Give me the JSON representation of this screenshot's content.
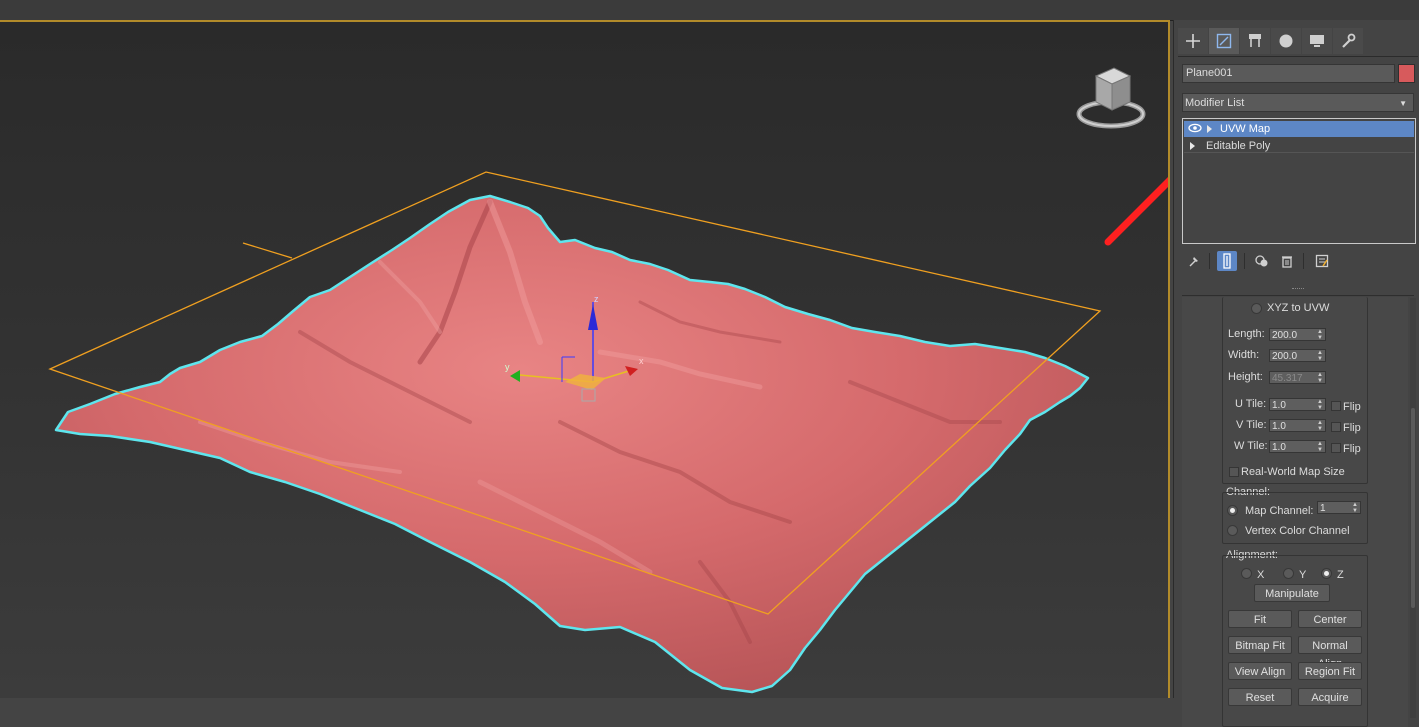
{
  "object": {
    "name": "Plane001",
    "color": "#d75a5c"
  },
  "modifier_list": {
    "label": "Modifier List"
  },
  "modifier_stack": [
    {
      "label": "UVW Map",
      "selected": true
    },
    {
      "label": "Editable Poly",
      "selected": false
    }
  ],
  "command_tabs": [
    "create-icon",
    "modify-icon",
    "hierarchy-icon",
    "motion-icon",
    "display-icon",
    "utilities-icon"
  ],
  "stack_tools": [
    "pin-stack-icon",
    "show-end-result-icon",
    "make-unique-icon",
    "remove-modifier-icon",
    "configure-modifier-sets-icon"
  ],
  "parameters": {
    "xyz_to_uvw": "XYZ to UVW",
    "length": {
      "label": "Length:",
      "value": "200.0"
    },
    "width": {
      "label": "Width:",
      "value": "200.0"
    },
    "height": {
      "label": "Height:",
      "value": "45.317"
    },
    "u_tile": {
      "label": "U Tile:",
      "value": "1.0",
      "flip": "Flip"
    },
    "v_tile": {
      "label": "V Tile:",
      "value": "1.0",
      "flip": "Flip"
    },
    "w_tile": {
      "label": "W Tile:",
      "value": "1.0",
      "flip": "Flip"
    },
    "real_world": "Real-World Map Size"
  },
  "channel": {
    "title": "Channel:",
    "map_channel": {
      "label": "Map Channel:",
      "value": "1"
    },
    "vertex_color": "Vertex Color Channel"
  },
  "alignment": {
    "title": "Alignment:",
    "axes": [
      "X",
      "Y",
      "Z"
    ],
    "selected_axis": "Z",
    "buttons": [
      "Manipulate",
      "Fit",
      "Center",
      "Bitmap Fit",
      "Normal Align",
      "View Align",
      "Region Fit",
      "Reset",
      "Acquire"
    ]
  },
  "gizmo_labels": {
    "x": "x",
    "y": "y",
    "z": "z"
  },
  "colors": {
    "selection_outline": "#5ee6ee",
    "gizmo": "#f0a020",
    "accent": "#5d87c6",
    "annotation_arrow": "#ff2020"
  }
}
